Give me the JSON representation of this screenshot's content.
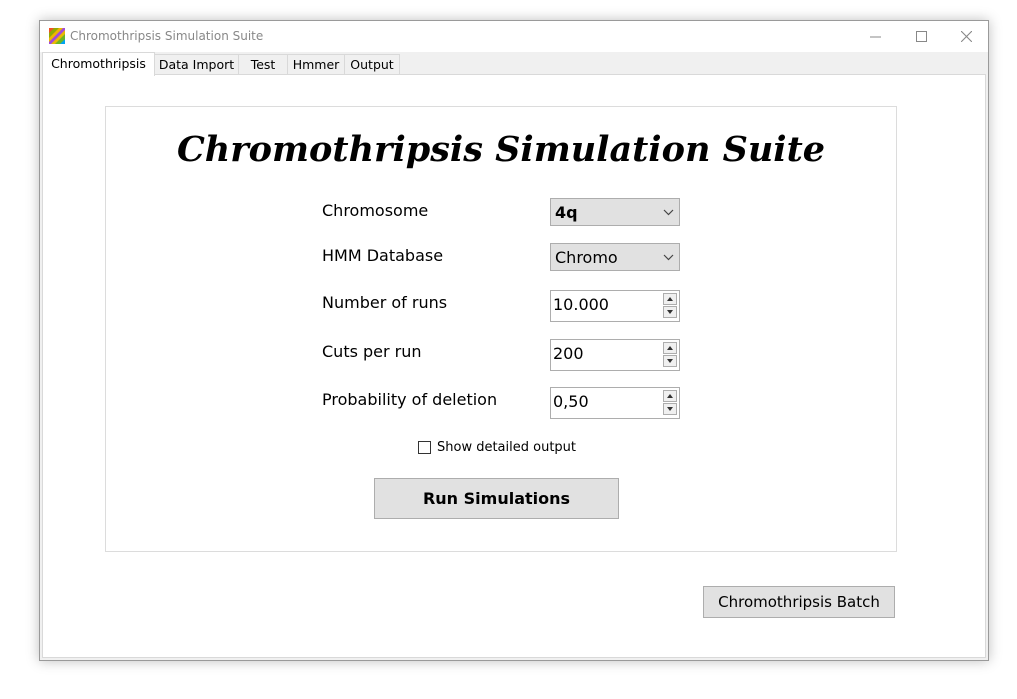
{
  "window": {
    "title": "Chromothripsis Simulation Suite"
  },
  "tabs": [
    {
      "label": "Chromothripsis"
    },
    {
      "label": "Data Import"
    },
    {
      "label": "Test"
    },
    {
      "label": "Hmmer"
    },
    {
      "label": "Output"
    }
  ],
  "main": {
    "heading": "Chromothripsis Simulation Suite",
    "chromosome": {
      "label": "Chromosome",
      "value": "4q"
    },
    "hmm_database": {
      "label": "HMM Database",
      "value": "Chromo"
    },
    "number_of_runs": {
      "label": "Number of runs",
      "value": "10.000"
    },
    "cuts_per_run": {
      "label": "Cuts per run",
      "value": "200"
    },
    "probability_of_deletion": {
      "label": "Probability of deletion",
      "value": "0,50"
    },
    "detailed_output": {
      "label": "Show detailed output",
      "checked": false
    },
    "run_button": "Run Simulations"
  },
  "batch_button": "Chromothripsis Batch"
}
